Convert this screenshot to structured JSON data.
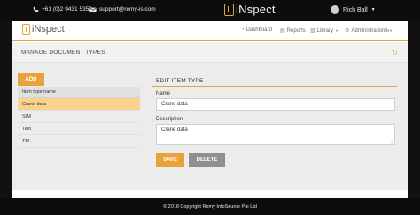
{
  "topbar": {
    "phone": "+61 (0)2 9431 5350",
    "email": "support@remy-is.com",
    "logo_text": "iNspect",
    "user_name": "Rich Ball"
  },
  "header": {
    "logo_text": "iNspect",
    "nav": {
      "dashboard": "Dashboard",
      "reports": "Reports",
      "library": "Library",
      "administration": "Administration"
    }
  },
  "section": {
    "title": "MANAGE DOCUMENT TYPES"
  },
  "list": {
    "add_label": "ADD",
    "column_header": "Item type name",
    "items": [
      "Crane data",
      "SIM",
      "Test",
      "TPI"
    ],
    "selected_index": 0
  },
  "edit": {
    "title": "EDIT ITEM TYPE",
    "name_label": "Name",
    "name_value": "Crane data",
    "description_label": "Description",
    "description_value": "Crane data",
    "save_label": "SAVE",
    "delete_label": "DELETE"
  },
  "footer": {
    "copyright": "© 2018 Copyright  Remy InfoSource Pte Ltd"
  },
  "colors": {
    "accent": "#e7a23a",
    "selected_row": "#f9d38e",
    "delete_button": "#8f8f8f",
    "topbar": "#0c0c0c"
  }
}
